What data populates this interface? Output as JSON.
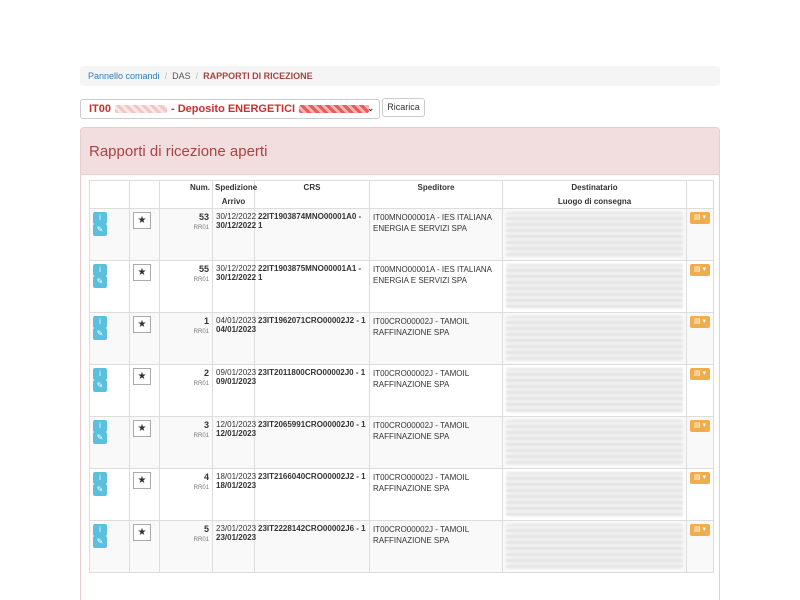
{
  "breadcrumb": {
    "home": "Pannello comandi",
    "section": "DAS",
    "current": "RAPPORTI DI RICEZIONE"
  },
  "depot_select": {
    "prefix": "IT00",
    "label": "- Deposito ENERGETICI"
  },
  "reload_label": "Ricarica",
  "panel_title": "Rapporti di ricezione aperti",
  "columns": {
    "num": "Num.",
    "spedizione": "Spedizione",
    "arrivo": "Arrivo",
    "crs": "CRS",
    "speditore": "Speditore",
    "destinatario": "Destinatario",
    "luogo": "Luogo di consegna"
  },
  "rows": [
    {
      "num": "53",
      "sub": "RR01",
      "ship": "30/12/2022",
      "arr": "30/12/2022",
      "crs": "22IT1903874MNO00001A0 - 1",
      "sender": "IT00MNO00001A - IES ITALIANA ENERGIA E SERVIZI SPA"
    },
    {
      "num": "55",
      "sub": "RR01",
      "ship": "30/12/2022",
      "arr": "30/12/2022",
      "crs": "22IT1903875MNO00001A1 - 1",
      "sender": "IT00MNO00001A - IES ITALIANA ENERGIA E SERVIZI SPA"
    },
    {
      "num": "1",
      "sub": "RR01",
      "ship": "04/01/2023",
      "arr": "04/01/2023",
      "crs": "23IT1962071CRO00002J2 - 1",
      "sender": "IT00CRO00002J - TAMOIL RAFFINAZIONE SPA"
    },
    {
      "num": "2",
      "sub": "RR01",
      "ship": "09/01/2023",
      "arr": "09/01/2023",
      "crs": "23IT2011800CRO00002J0 - 1",
      "sender": "IT00CRO00002J - TAMOIL RAFFINAZIONE SPA"
    },
    {
      "num": "3",
      "sub": "RR01",
      "ship": "12/01/2023",
      "arr": "12/01/2023",
      "crs": "23IT2065991CRO00002J0 - 1",
      "sender": "IT00CRO00002J - TAMOIL RAFFINAZIONE SPA"
    },
    {
      "num": "4",
      "sub": "RR01",
      "ship": "18/01/2023",
      "arr": "18/01/2023",
      "crs": "23IT2166040CRO00002J2 - 1",
      "sender": "IT00CRO00002J - TAMOIL RAFFINAZIONE SPA"
    },
    {
      "num": "5",
      "sub": "RR01",
      "ship": "23/01/2023",
      "arr": "23/01/2023",
      "crs": "23IT2228142CRO00002J6 - 1",
      "sender": "IT00CRO00002J - TAMOIL RAFFINAZIONE SPA"
    }
  ],
  "colors": {
    "danger_heading": "#f2dede",
    "danger_text": "#a94442",
    "info_button": "#5bc0de",
    "warning_button": "#f0ad4e"
  },
  "icons": {
    "info": "info-icon",
    "edit": "edit-icon",
    "stamp": "stamp-icon",
    "document": "document-icon"
  }
}
